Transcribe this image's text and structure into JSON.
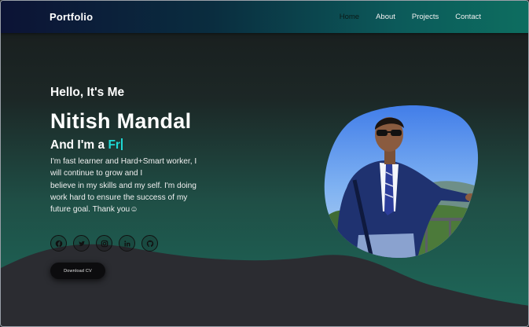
{
  "navbar": {
    "logo": "Portfolio",
    "links": [
      "Home",
      "About",
      "Projects",
      "Contact"
    ]
  },
  "hero": {
    "greeting": "Hello, It's Me",
    "name": "Nitish Mandal",
    "role_prefix": "And I'm a ",
    "role_typed": "Fr",
    "bio_lines": [
      "I'm fast learner and Hard+Smart worker, I",
      "will continue to grow and I",
      "believe in my skills and my self. I'm doing",
      "work hard to ensure the success of my",
      "future goal. Thank you☺"
    ],
    "cv_button": "Download CV"
  },
  "socials": [
    {
      "icon": "facebook-icon"
    },
    {
      "icon": "twitter-icon"
    },
    {
      "icon": "instagram-icon"
    },
    {
      "icon": "linkedin-icon"
    },
    {
      "icon": "github-icon"
    }
  ],
  "colors": {
    "accent": "#1ed8d4",
    "nav_start": "#0c1335",
    "nav_end": "#0d6e60",
    "wave": "#2b2c31"
  }
}
